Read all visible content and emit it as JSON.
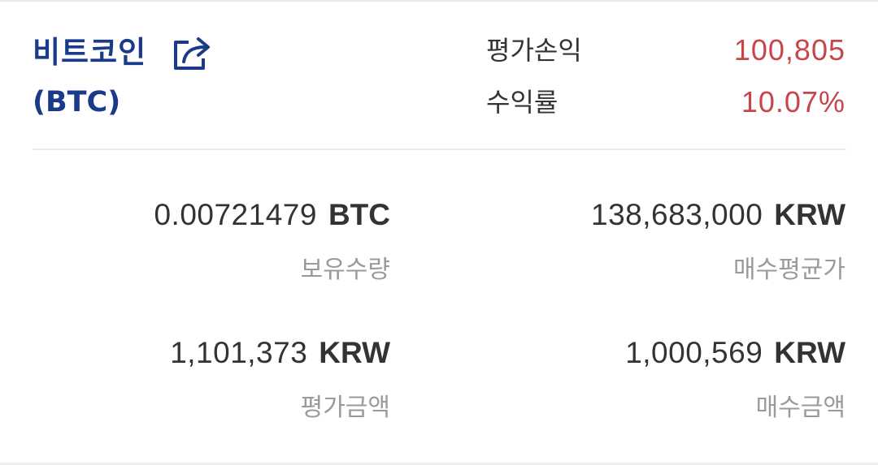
{
  "coin": {
    "name": "비트코인",
    "symbol": "(BTC)"
  },
  "summary": {
    "profit_label": "평가손익",
    "profit_value": "100,805",
    "rate_label": "수익률",
    "rate_value": "10.07%"
  },
  "details": {
    "holding": {
      "value": "0.00721479",
      "unit": "BTC",
      "label": "보유수량"
    },
    "avg_price": {
      "value": "138,683,000",
      "unit": "KRW",
      "label": "매수평균가"
    },
    "eval_amount": {
      "value": "1,101,373",
      "unit": "KRW",
      "label": "평가금액"
    },
    "buy_amount": {
      "value": "1,000,569",
      "unit": "KRW",
      "label": "매수금액"
    }
  },
  "colors": {
    "brand": "#1b3a8a",
    "profit": "#c8454c"
  },
  "icons": {
    "share": "share-icon"
  }
}
